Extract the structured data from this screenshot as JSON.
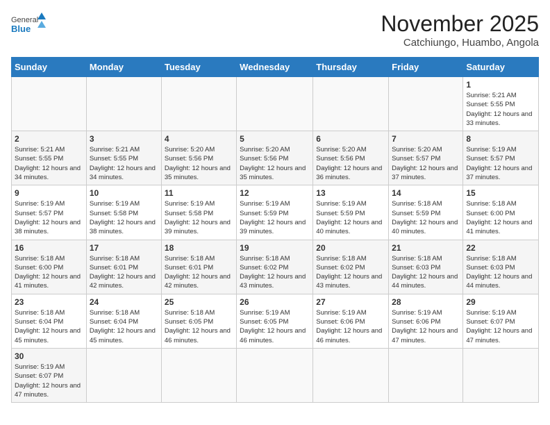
{
  "logo": {
    "text_general": "General",
    "text_blue": "Blue"
  },
  "title": "November 2025",
  "location": "Catchiungo, Huambo, Angola",
  "weekdays": [
    "Sunday",
    "Monday",
    "Tuesday",
    "Wednesday",
    "Thursday",
    "Friday",
    "Saturday"
  ],
  "weeks": [
    [
      {
        "day": "",
        "info": ""
      },
      {
        "day": "",
        "info": ""
      },
      {
        "day": "",
        "info": ""
      },
      {
        "day": "",
        "info": ""
      },
      {
        "day": "",
        "info": ""
      },
      {
        "day": "",
        "info": ""
      },
      {
        "day": "1",
        "info": "Sunrise: 5:21 AM\nSunset: 5:55 PM\nDaylight: 12 hours and 33 minutes."
      }
    ],
    [
      {
        "day": "2",
        "info": "Sunrise: 5:21 AM\nSunset: 5:55 PM\nDaylight: 12 hours and 34 minutes."
      },
      {
        "day": "3",
        "info": "Sunrise: 5:21 AM\nSunset: 5:55 PM\nDaylight: 12 hours and 34 minutes."
      },
      {
        "day": "4",
        "info": "Sunrise: 5:20 AM\nSunset: 5:56 PM\nDaylight: 12 hours and 35 minutes."
      },
      {
        "day": "5",
        "info": "Sunrise: 5:20 AM\nSunset: 5:56 PM\nDaylight: 12 hours and 35 minutes."
      },
      {
        "day": "6",
        "info": "Sunrise: 5:20 AM\nSunset: 5:56 PM\nDaylight: 12 hours and 36 minutes."
      },
      {
        "day": "7",
        "info": "Sunrise: 5:20 AM\nSunset: 5:57 PM\nDaylight: 12 hours and 37 minutes."
      },
      {
        "day": "8",
        "info": "Sunrise: 5:19 AM\nSunset: 5:57 PM\nDaylight: 12 hours and 37 minutes."
      }
    ],
    [
      {
        "day": "9",
        "info": "Sunrise: 5:19 AM\nSunset: 5:57 PM\nDaylight: 12 hours and 38 minutes."
      },
      {
        "day": "10",
        "info": "Sunrise: 5:19 AM\nSunset: 5:58 PM\nDaylight: 12 hours and 38 minutes."
      },
      {
        "day": "11",
        "info": "Sunrise: 5:19 AM\nSunset: 5:58 PM\nDaylight: 12 hours and 39 minutes."
      },
      {
        "day": "12",
        "info": "Sunrise: 5:19 AM\nSunset: 5:59 PM\nDaylight: 12 hours and 39 minutes."
      },
      {
        "day": "13",
        "info": "Sunrise: 5:19 AM\nSunset: 5:59 PM\nDaylight: 12 hours and 40 minutes."
      },
      {
        "day": "14",
        "info": "Sunrise: 5:18 AM\nSunset: 5:59 PM\nDaylight: 12 hours and 40 minutes."
      },
      {
        "day": "15",
        "info": "Sunrise: 5:18 AM\nSunset: 6:00 PM\nDaylight: 12 hours and 41 minutes."
      }
    ],
    [
      {
        "day": "16",
        "info": "Sunrise: 5:18 AM\nSunset: 6:00 PM\nDaylight: 12 hours and 41 minutes."
      },
      {
        "day": "17",
        "info": "Sunrise: 5:18 AM\nSunset: 6:01 PM\nDaylight: 12 hours and 42 minutes."
      },
      {
        "day": "18",
        "info": "Sunrise: 5:18 AM\nSunset: 6:01 PM\nDaylight: 12 hours and 42 minutes."
      },
      {
        "day": "19",
        "info": "Sunrise: 5:18 AM\nSunset: 6:02 PM\nDaylight: 12 hours and 43 minutes."
      },
      {
        "day": "20",
        "info": "Sunrise: 5:18 AM\nSunset: 6:02 PM\nDaylight: 12 hours and 43 minutes."
      },
      {
        "day": "21",
        "info": "Sunrise: 5:18 AM\nSunset: 6:03 PM\nDaylight: 12 hours and 44 minutes."
      },
      {
        "day": "22",
        "info": "Sunrise: 5:18 AM\nSunset: 6:03 PM\nDaylight: 12 hours and 44 minutes."
      }
    ],
    [
      {
        "day": "23",
        "info": "Sunrise: 5:18 AM\nSunset: 6:04 PM\nDaylight: 12 hours and 45 minutes."
      },
      {
        "day": "24",
        "info": "Sunrise: 5:18 AM\nSunset: 6:04 PM\nDaylight: 12 hours and 45 minutes."
      },
      {
        "day": "25",
        "info": "Sunrise: 5:18 AM\nSunset: 6:05 PM\nDaylight: 12 hours and 46 minutes."
      },
      {
        "day": "26",
        "info": "Sunrise: 5:19 AM\nSunset: 6:05 PM\nDaylight: 12 hours and 46 minutes."
      },
      {
        "day": "27",
        "info": "Sunrise: 5:19 AM\nSunset: 6:06 PM\nDaylight: 12 hours and 46 minutes."
      },
      {
        "day": "28",
        "info": "Sunrise: 5:19 AM\nSunset: 6:06 PM\nDaylight: 12 hours and 47 minutes."
      },
      {
        "day": "29",
        "info": "Sunrise: 5:19 AM\nSunset: 6:07 PM\nDaylight: 12 hours and 47 minutes."
      }
    ],
    [
      {
        "day": "30",
        "info": "Sunrise: 5:19 AM\nSunset: 6:07 PM\nDaylight: 12 hours and 47 minutes."
      },
      {
        "day": "",
        "info": ""
      },
      {
        "day": "",
        "info": ""
      },
      {
        "day": "",
        "info": ""
      },
      {
        "day": "",
        "info": ""
      },
      {
        "day": "",
        "info": ""
      },
      {
        "day": "",
        "info": ""
      }
    ]
  ]
}
